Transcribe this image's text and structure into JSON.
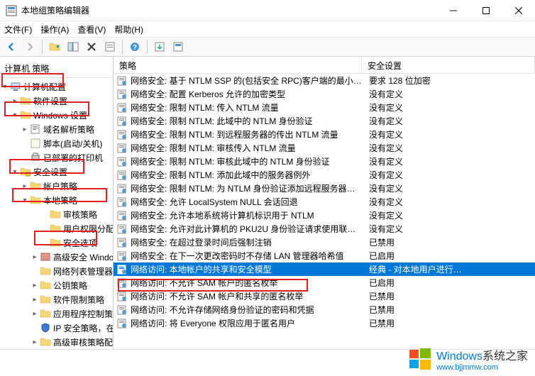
{
  "window": {
    "title": "本地组策略编辑器"
  },
  "menu": {
    "file": "文件(F)",
    "action": "操作(A)",
    "view": "查看(V)",
    "help": "帮助(H)"
  },
  "tree": {
    "header": "计算机 策略",
    "root": "计算机配置",
    "software": "软件设置",
    "windows": "Windows 设置",
    "dns": "域名解析策略",
    "scripts": "脚本(启动/关机)",
    "printers": "已部署的打印机",
    "security": "安全设置",
    "account": "帐户策略",
    "local": "本地策略",
    "audit": "审核策略",
    "userright": "用户权限分配",
    "secopt": "安全选项",
    "winsec": "高级安全 Windows",
    "netlist": "网络列表管理器",
    "pubkey": "公钥策略",
    "softrestrict": "软件限制策略",
    "appcontrol": "应用程序控制策略",
    "ipsec": "IP 安全策略，在",
    "advaudit": "高级审核策略配置"
  },
  "list": {
    "col_policy": "策略",
    "col_setting": "安全设置",
    "rows": [
      {
        "p": "网络安全: 基于 NTLM SSP 的(包括安全 RPC)客户端的最小…",
        "s": "要求 128 位加密"
      },
      {
        "p": "网络安全: 配置 Kerberos 允许的加密类型",
        "s": "没有定义"
      },
      {
        "p": "网络安全: 限制 NTLM: 传入 NTLM 流量",
        "s": "没有定义"
      },
      {
        "p": "网络安全: 限制 NTLM: 此域中的 NTLM 身份验证",
        "s": "没有定义"
      },
      {
        "p": "网络安全: 限制 NTLM: 到远程服务器的传出 NTLM 流量",
        "s": "没有定义"
      },
      {
        "p": "网络安全: 限制 NTLM: 审核传入 NTLM 流量",
        "s": "没有定义"
      },
      {
        "p": "网络安全: 限制 NTLM: 审核此域中的 NTLM 身份验证",
        "s": "没有定义"
      },
      {
        "p": "网络安全: 限制 NTLM: 添加此域中的服务器例外",
        "s": "没有定义"
      },
      {
        "p": "网络安全: 限制 NTLM: 为 NTLM 身份验证添加远程服务器…",
        "s": "没有定义"
      },
      {
        "p": "网络安全: 允许 LocalSystem NULL 会话回退",
        "s": "没有定义"
      },
      {
        "p": "网络安全: 允许本地系统将计算机标识用于 NTLM",
        "s": "没有定义"
      },
      {
        "p": "网络安全: 允许对此计算机的 PKU2U 身份验证请求使用联…",
        "s": "没有定义"
      },
      {
        "p": "网络安全: 在超过登录时间后强制注销",
        "s": "已禁用"
      },
      {
        "p": "网络安全: 在下一次更改密码时不存储 LAN 管理器哈希值",
        "s": "已启用"
      },
      {
        "p": "网络访问: 本地帐户的共享和安全模型",
        "s": "经典 - 对本地用户进行…",
        "sel": true
      },
      {
        "p": "网络访问: 不允许 SAM 帐户的匿名枚举",
        "s": "已启用"
      },
      {
        "p": "网络访问: 不允许 SAM 帐户和共享的匿名枚举",
        "s": "已禁用"
      },
      {
        "p": "网络访问: 不允许存储网络身份验证的密码和凭据",
        "s": "已禁用"
      },
      {
        "p": "网络访问: 将 Everyone 权限应用于匿名用户",
        "s": "已禁用"
      }
    ]
  },
  "watermark": {
    "brand": "Windows",
    "sub": "系统之家",
    "url": "www.bjjmmw.com"
  }
}
